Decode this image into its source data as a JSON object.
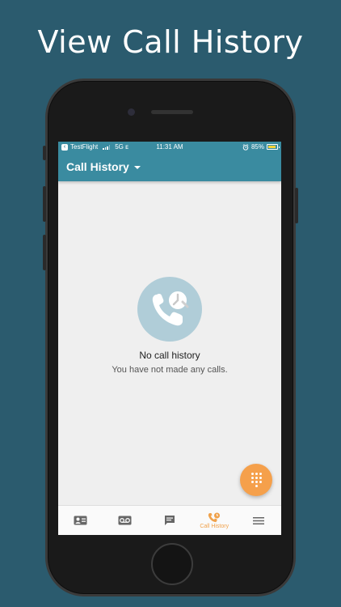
{
  "headline": "View Call History",
  "status_bar": {
    "carrier": "TestFlight",
    "network": "5G ᴇ",
    "time": "11:31 AM",
    "battery_percent": "85%",
    "battery_level": 0.85
  },
  "app_bar": {
    "title": "Call History"
  },
  "empty_state": {
    "title": "No call history",
    "subtitle": "You have not made any calls."
  },
  "tab_bar": {
    "active_tab": "Call History",
    "tabs": [
      {
        "icon": "contacts-icon",
        "label": ""
      },
      {
        "icon": "voicemail-icon",
        "label": ""
      },
      {
        "icon": "messages-icon",
        "label": ""
      },
      {
        "icon": "call-history-icon",
        "label": "Call History"
      },
      {
        "icon": "menu-icon",
        "label": ""
      }
    ]
  },
  "colors": {
    "background": "#2b5b6e",
    "app_bar": "#3a8ba0",
    "accent": "#f5a04b",
    "empty_icon_bg": "#b0cdd8",
    "inactive_icon": "#666666"
  }
}
